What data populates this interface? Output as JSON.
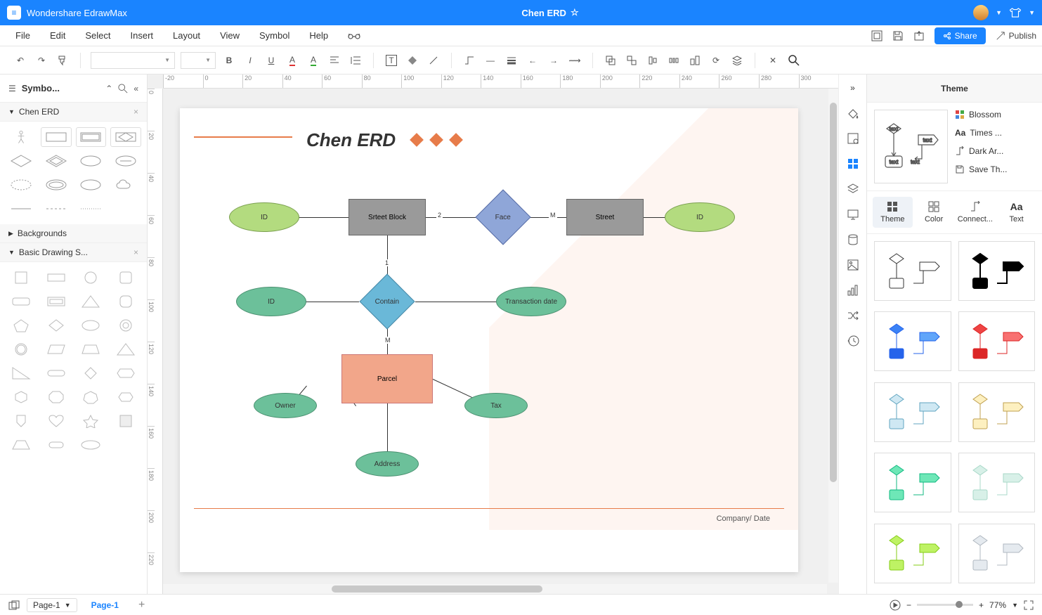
{
  "app": {
    "name": "Wondershare EdrawMax",
    "doc_title": "Chen ERD"
  },
  "menubar": {
    "items": [
      "File",
      "Edit",
      "Select",
      "Insert",
      "Layout",
      "View",
      "Symbol",
      "Help"
    ],
    "share": "Share",
    "publish": "Publish"
  },
  "left_panel": {
    "title": "Symbo...",
    "stencils": {
      "chen": "Chen ERD",
      "backgrounds": "Backgrounds",
      "basic": "Basic Drawing S..."
    }
  },
  "ruler_h": [
    "-20",
    "0",
    "20",
    "40",
    "60",
    "80",
    "100",
    "120",
    "140",
    "160",
    "180",
    "200",
    "220",
    "240",
    "260",
    "280",
    "300"
  ],
  "ruler_v": [
    "0",
    "20",
    "40",
    "60",
    "80",
    "100",
    "120",
    "140",
    "160",
    "180",
    "200",
    "220"
  ],
  "canvas": {
    "title": "Chen ERD",
    "nodes": {
      "srteet_block": "Srteet Block",
      "street": "Street",
      "id1": "ID",
      "id2": "ID",
      "id3": "ID",
      "face": "Face",
      "contain": "Contain",
      "transaction_date": "Transaction date",
      "parcel": "Parcel",
      "owner": "Owner",
      "tax": "Tax",
      "address": "Address"
    },
    "labels": {
      "two": "2",
      "m1": "M",
      "one": "1",
      "m2": "M"
    },
    "footer": "Company/ Date"
  },
  "right_panel": {
    "title": "Theme",
    "preview_text": "text",
    "opts": {
      "blossom": "Blossom",
      "times": "Times ...",
      "dark": "Dark Ar...",
      "save": "Save Th..."
    },
    "tabs": {
      "theme": "Theme",
      "color": "Color",
      "connector": "Connect...",
      "text": "Text"
    }
  },
  "statusbar": {
    "page_sel": "Page-1",
    "tab": "Page-1",
    "zoom": "77%"
  }
}
